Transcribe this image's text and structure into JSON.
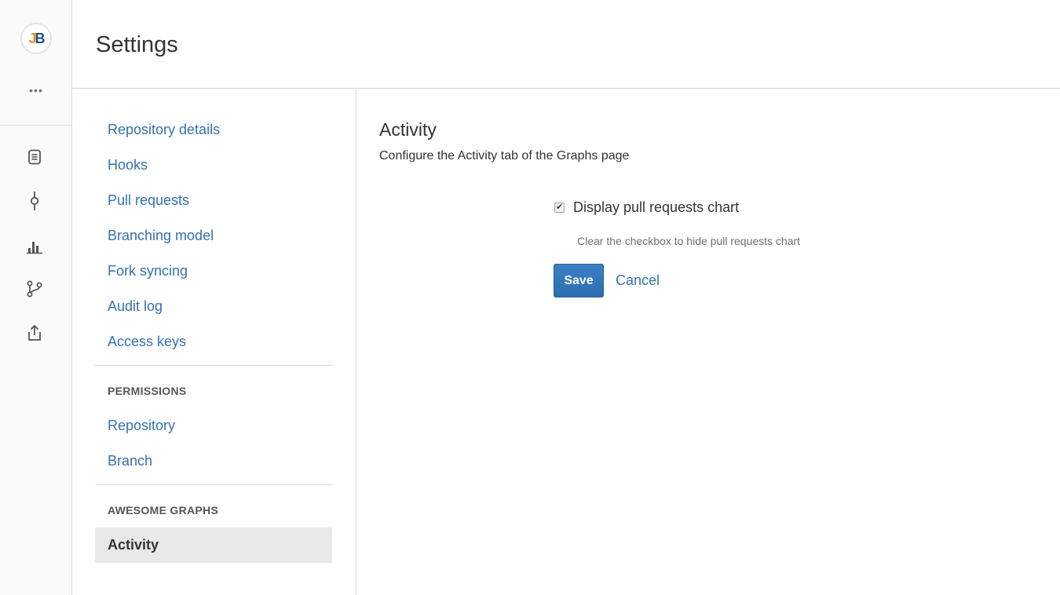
{
  "rail": {
    "avatar": {
      "initial_j": "J",
      "initial_b": "B"
    },
    "more_label": "•••",
    "icons": [
      "source-icon",
      "commits-icon",
      "graphs-icon",
      "branches-icon",
      "share-icon"
    ]
  },
  "header": {
    "title": "Settings"
  },
  "settings_nav": {
    "items": [
      {
        "label": "Repository details"
      },
      {
        "label": "Hooks"
      },
      {
        "label": "Pull requests"
      },
      {
        "label": "Branching model"
      },
      {
        "label": "Fork syncing"
      },
      {
        "label": "Audit log"
      },
      {
        "label": "Access keys"
      }
    ],
    "permissions": {
      "heading": "PERMISSIONS",
      "items": [
        {
          "label": "Repository"
        },
        {
          "label": "Branch"
        }
      ]
    },
    "awesome_graphs": {
      "heading": "AWESOME GRAPHS",
      "items": [
        {
          "label": "Activity",
          "active": true
        }
      ]
    }
  },
  "main": {
    "title": "Activity",
    "description": "Configure the Activity tab of the Graphs page",
    "checkbox": {
      "label": "Display pull requests chart",
      "checked": true,
      "check_glyph": "✔"
    },
    "hint": "Clear the checkbox to hide pull requests chart",
    "save_label": "Save",
    "cancel_label": "Cancel"
  },
  "colors": {
    "link": "#3572b0",
    "primary_button": "#3b7fc4",
    "active_nav_bg": "#e8e8e8",
    "avatar_j": "#f08a24",
    "avatar_b": "#205081"
  }
}
